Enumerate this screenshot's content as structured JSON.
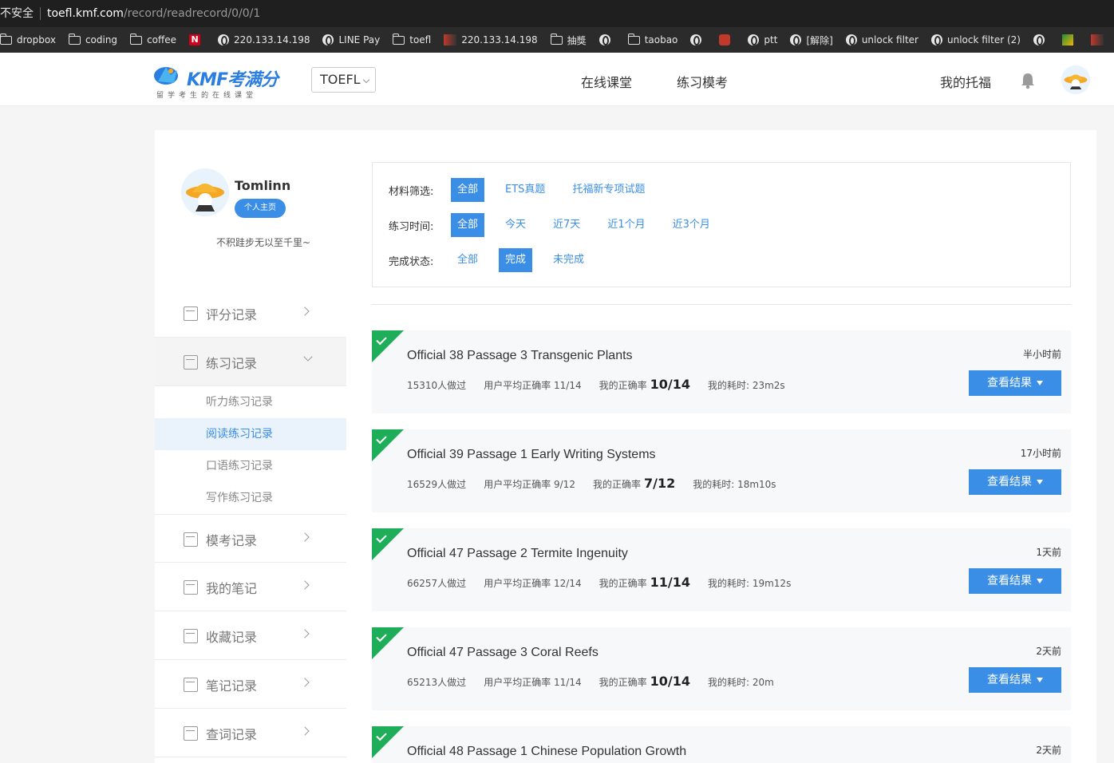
{
  "browser": {
    "insecure_label": "不安全",
    "url_host": "toefl.kmf.com",
    "url_path": "/record/readrecord/0/0/1"
  },
  "bookmarks": [
    {
      "label": "dropbox",
      "icon": "folder-icon"
    },
    {
      "label": "coding",
      "icon": "folder-icon"
    },
    {
      "label": "coffee",
      "icon": "folder-icon"
    },
    {
      "label": "",
      "icon": "netflix-icon"
    },
    {
      "label": "220.133.14.198",
      "icon": "globe-icon"
    },
    {
      "label": "LINE Pay",
      "icon": "globe-icon"
    },
    {
      "label": "toefl",
      "icon": "folder-icon"
    },
    {
      "label": "220.133.14.198",
      "icon": "image-icon"
    },
    {
      "label": "抽獎",
      "icon": "folder-icon"
    },
    {
      "label": "",
      "icon": "globe-icon"
    },
    {
      "label": "taobao",
      "icon": "folder-icon"
    },
    {
      "label": "",
      "icon": "globe-icon"
    },
    {
      "label": "",
      "icon": "shop-icon"
    },
    {
      "label": "ptt",
      "icon": "globe-icon"
    },
    {
      "label": "[解除]",
      "icon": "globe-icon"
    },
    {
      "label": "unlock filter",
      "icon": "globe-icon"
    },
    {
      "label": "unlock filter (2)",
      "icon": "globe-icon"
    },
    {
      "label": "",
      "icon": "globe-icon"
    },
    {
      "label": "",
      "icon": "grid-icon"
    },
    {
      "label": "",
      "icon": "image-icon"
    },
    {
      "label": "",
      "icon": "globe-icon"
    }
  ],
  "header": {
    "logo_text": "KMF考满分",
    "logo_sub": "留学考生的在线课堂",
    "exam_select": "TOEFL",
    "nav_course": "在线课堂",
    "nav_practice": "练习模考",
    "nav_my": "我的托福"
  },
  "profile": {
    "name": "Tomlinn",
    "home_button": "个人主页",
    "motto": "不积跬步无以至千里~"
  },
  "menu": {
    "score": "评分记录",
    "practice": "练习记录",
    "sub_listening": "听力练习记录",
    "sub_reading": "阅读练习记录",
    "sub_speaking": "口语练习记录",
    "sub_writing": "写作练习记录",
    "mock": "模考记录",
    "notes": "我的笔记",
    "favorites": "收藏记录",
    "note_records": "笔记记录",
    "lookup": "查词记录"
  },
  "filters": {
    "material_label": "材料筛选:",
    "material_options": [
      "全部",
      "ETS真题",
      "托福新专项试题"
    ],
    "time_label": "练习时间:",
    "time_options": [
      "全部",
      "今天",
      "近7天",
      "近1个月",
      "近3个月"
    ],
    "status_label": "完成状态:",
    "status_options": [
      "全部",
      "完成",
      "未完成"
    ]
  },
  "records": [
    {
      "title": "Official 38 Passage 3  Transgenic Plants",
      "when": "半小时前",
      "count": "15310人做过",
      "avg": "用户平均正确率 11/14",
      "mine_label": "我的正确率",
      "mine": "10/14",
      "time": "我的耗时: 23m2s",
      "button": "查看结果"
    },
    {
      "title": "Official 39 Passage 1  Early Writing Systems",
      "when": "17小时前",
      "count": "16529人做过",
      "avg": "用户平均正确率 9/12",
      "mine_label": "我的正确率",
      "mine": "7/12",
      "time": "我的耗时: 18m10s",
      "button": "查看结果"
    },
    {
      "title": "Official 47 Passage 2  Termite Ingenuity",
      "when": "1天前",
      "count": "66257人做过",
      "avg": "用户平均正确率 12/14",
      "mine_label": "我的正确率",
      "mine": "11/14",
      "time": "我的耗时: 19m12s",
      "button": "查看结果"
    },
    {
      "title": "Official 47 Passage 3  Coral Reefs",
      "when": "2天前",
      "count": "65213人做过",
      "avg": "用户平均正确率 11/14",
      "mine_label": "我的正确率",
      "mine": "10/14",
      "time": "我的耗时: 20m",
      "button": "查看结果"
    },
    {
      "title": "Official 48 Passage 1  Chinese Population Growth",
      "when": "2天前"
    }
  ],
  "colors": {
    "accent": "#3a8ee6",
    "done": "#1eae5a"
  }
}
